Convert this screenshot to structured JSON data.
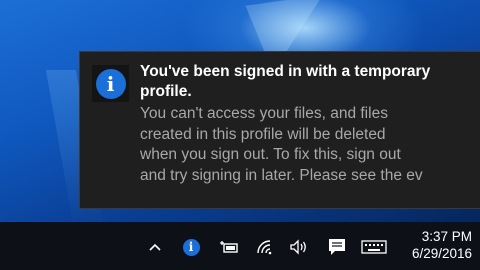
{
  "toast": {
    "icon": "info-icon",
    "icon_glyph": "i",
    "title": "You've been signed in with a temporary profile.",
    "body_lines": [
      "You can't access your files, and files",
      "created in this profile will be deleted",
      "when you sign out. To fix this, sign out",
      "and try signing in later.  Please see the ev"
    ]
  },
  "taskbar": {
    "tray_icons": [
      "chevron-up-icon",
      "info-icon",
      "power-battery-icon",
      "wifi-icon",
      "volume-icon",
      "action-center-icon",
      "keyboard-icon"
    ],
    "clock": {
      "time": "3:37 PM",
      "date": "6/29/2016"
    }
  },
  "colors": {
    "toast_bg": "#1f1f1f",
    "toast_title": "#ffffff",
    "toast_body": "#a8a8a8",
    "accent_blue": "#1a6fd8",
    "taskbar_bg": "#0d1117"
  }
}
